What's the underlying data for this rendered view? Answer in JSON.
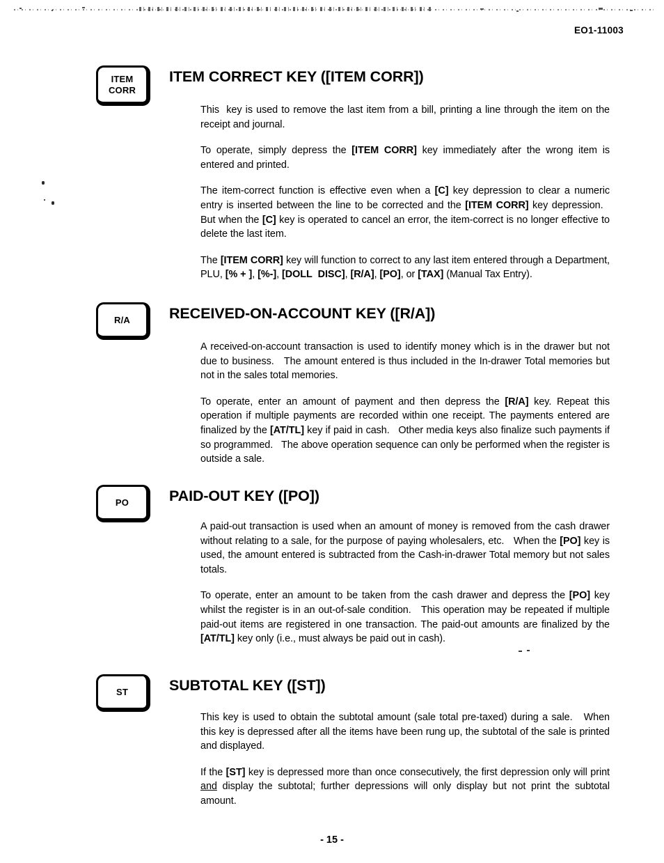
{
  "page": {
    "document_code": "EO1-11003",
    "page_number": "- 15 -"
  },
  "sections": [
    {
      "keycap_lines": [
        "ITEM",
        "CORR"
      ],
      "heading": "ITEM CORRECT KEY ([ITEM CORR])",
      "paragraphs": [
        "This  key is used to remove the last item from a bill, printing a line through the item on the receipt and journal.",
        "To operate, simply depress the [ITEM CORR] key immediately after the wrong item is entered and printed.",
        "The item-correct function is effective even when a [C] key depression to clear a numeric entry is inserted between the line to be corrected and the [ITEM CORR] key depression.   But when the [C] key is operated to cancel an error, the item-correct is no longer effective to delete the last item.",
        "The [ITEM CORR] key will function to correct to any last item entered through a Department, PLU, [% + ], [%-], [DOLL DISC], [R/A], [PO], or [TAX] (Manual Tax Entry)."
      ]
    },
    {
      "keycap_lines": [
        "R/A"
      ],
      "heading": "RECEIVED-ON-ACCOUNT KEY ([R/A])",
      "paragraphs": [
        "A received-on-account transaction is used to identify money which is in the drawer but not due to business.   The amount entered is thus included in the In-drawer Total memories but not in the sales total memories.",
        "To operate, enter an amount of payment and then depress the [R/A] key. Repeat this operation if multiple payments are recorded within one receipt. The payments entered are finalized by the [AT/TL] key if paid in cash.   Other media keys also finalize such payments if so programmed.   The above operation sequence can only be performed when the register is outside a sale."
      ]
    },
    {
      "keycap_lines": [
        "PO"
      ],
      "heading": "PAID-OUT KEY ([PO])",
      "paragraphs": [
        "A paid-out transaction is used when an amount of money is removed from the cash drawer without relating to a sale, for the purpose of paying wholesalers, etc.   When the [PO] key is used, the amount entered is subtracted from the Cash-in-drawer Total memory but not sales totals.",
        "To operate, enter an amount to be taken from the cash drawer and depress the [PO] key whilst the register is in an out-of-sale condition.   This operation may be repeated if multiple paid-out items are registered in one transaction. The paid-out amounts are finalized by the [AT/TL] key only (i.e., must always be paid out in cash)."
      ]
    },
    {
      "keycap_lines": [
        "ST"
      ],
      "heading": "SUBTOTAL KEY ([ST])",
      "paragraphs": [
        "This key is used to obtain the subtotal amount (sale total pre-taxed) during a sale.   When this key is depressed after all the items have been rung up, the subtotal of the sale is printed and displayed.",
        "If the [ST] key is depressed more than once consecutively, the first depression only will print and display the subtotal; further depressions will only display but not print the subtotal amount."
      ]
    }
  ]
}
